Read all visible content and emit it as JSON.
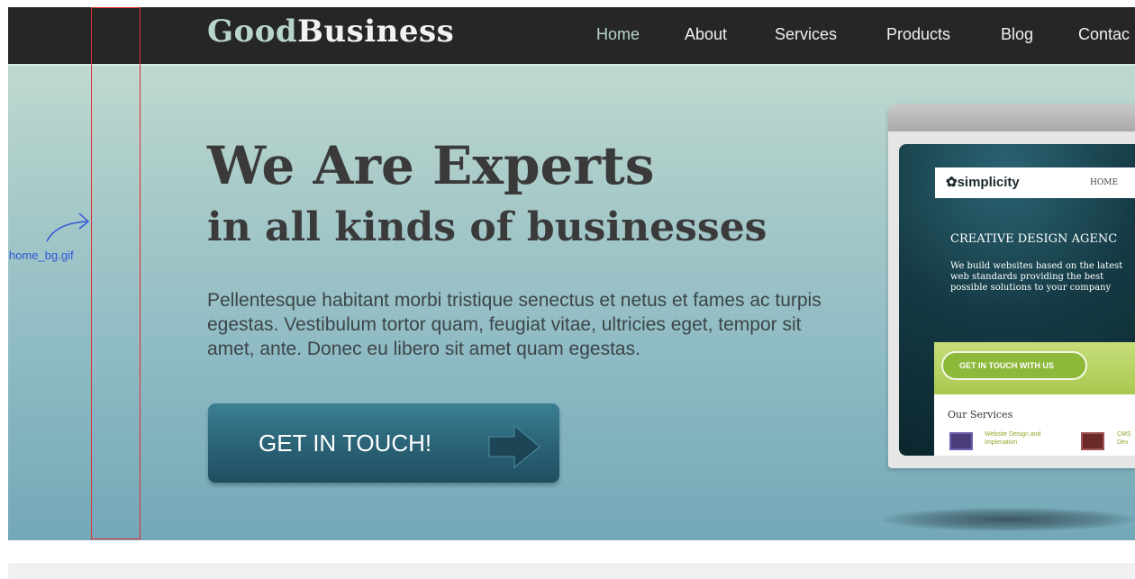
{
  "header": {
    "logo": {
      "part1": "Good",
      "part2": "Business"
    },
    "nav": [
      {
        "label": "Home",
        "active": true
      },
      {
        "label": "About"
      },
      {
        "label": "Services"
      },
      {
        "label": "Products"
      },
      {
        "label": "Blog"
      },
      {
        "label": "Contac"
      }
    ]
  },
  "hero": {
    "headline": "We Are Experts",
    "subheadline": "in all kinds of businesses",
    "text": "Pellentesque habitant morbi tristique senectus et netus et fames ac turpis egestas. Vestibulum tortor quam, feugiat vitae, ultricies eget, tempor sit amet, ante. Donec eu libero sit amet quam egestas.",
    "cta_label": "GET IN TOUCH!"
  },
  "annotation": {
    "label": "home_bg.gif"
  },
  "mockup": {
    "logo": "✿simplicity",
    "nav_home": "HOME",
    "title": "CREATIVE DESIGN AGENC",
    "text": "We build websites based on the latest web standards providing the best possible solutions to your company",
    "button": "GET IN TOUCH WITH US",
    "services_title": "Our Services",
    "service1": "Website Design and Implenation",
    "service2": "CMS Dev"
  },
  "colors": {
    "nav_bg": "#262626",
    "accent": "#b8d5cc",
    "cta_bg": "#2b6477"
  }
}
